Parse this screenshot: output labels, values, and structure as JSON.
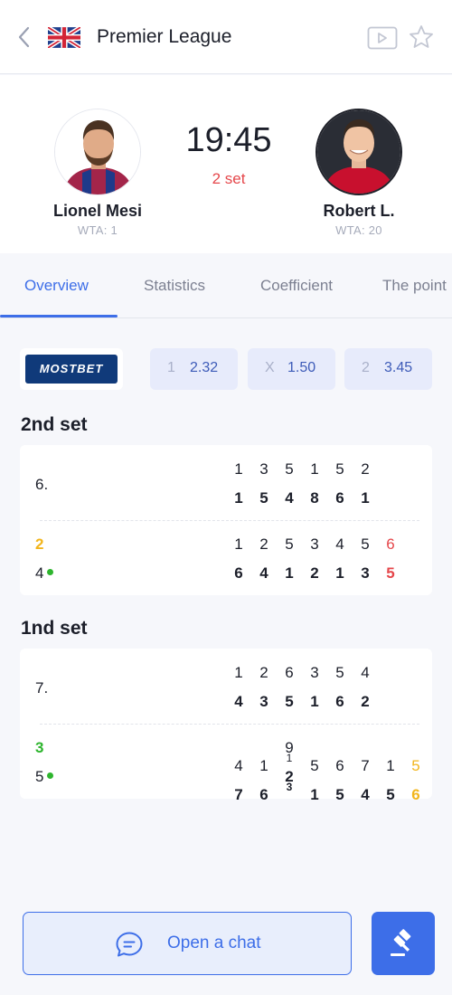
{
  "header": {
    "title": "Premier League",
    "icons": [
      "back-chevron-icon",
      "uk-flag-icon",
      "video-icon",
      "star-icon"
    ]
  },
  "match": {
    "time": "19:45",
    "set_label": "2 set",
    "player1": {
      "name": "Lionel Mesi",
      "rank": "WTA: 1"
    },
    "player2": {
      "name": "Robert L.",
      "rank": "WTA: 20"
    }
  },
  "tabs": [
    {
      "label": "Overview",
      "active": true
    },
    {
      "label": "Statistics",
      "active": false
    },
    {
      "label": "Coefficient",
      "active": false
    },
    {
      "label": "The point",
      "active": false
    }
  ],
  "odds": {
    "bookmaker": "MOSTBET",
    "items": [
      {
        "label": "1",
        "value": "2.32"
      },
      {
        "label": "X",
        "value": "1.50"
      },
      {
        "label": "2",
        "value": "3.45"
      }
    ]
  },
  "sets": [
    {
      "title": "2nd set",
      "upper": {
        "label": "6.",
        "top": [
          "1",
          "3",
          "5",
          "1",
          "5",
          "2"
        ],
        "bottom": [
          "1",
          "5",
          "4",
          "8",
          "6",
          "1"
        ]
      },
      "lower": {
        "label_top": "2",
        "label_bottom": "4",
        "top": [
          "1",
          "2",
          "5",
          "3",
          "4",
          "5",
          "6"
        ],
        "bottom": [
          "6",
          "4",
          "1",
          "2",
          "1",
          "3",
          "5"
        ]
      }
    },
    {
      "title": "1nd set",
      "upper": {
        "label": "7.",
        "top": [
          "1",
          "2",
          "6",
          "3",
          "5",
          "4"
        ],
        "bottom": [
          "4",
          "3",
          "5",
          "1",
          "6",
          "2"
        ]
      },
      "lower": {
        "label_top": "3",
        "label_bottom": "5",
        "top": [
          "4",
          "1",
          "9",
          "5",
          "6",
          "7",
          "1",
          "5"
        ],
        "top_sup": "1",
        "bottom": [
          "7",
          "6",
          "2",
          "1",
          "5",
          "4",
          "5",
          "6"
        ],
        "bottom_sup": "3"
      }
    }
  ],
  "footer": {
    "chat_label": "Open a chat"
  },
  "colors": {
    "accent": "#3d6ee8",
    "red": "#e5474b",
    "yellow": "#f2b51c",
    "green": "#2eb52e"
  }
}
